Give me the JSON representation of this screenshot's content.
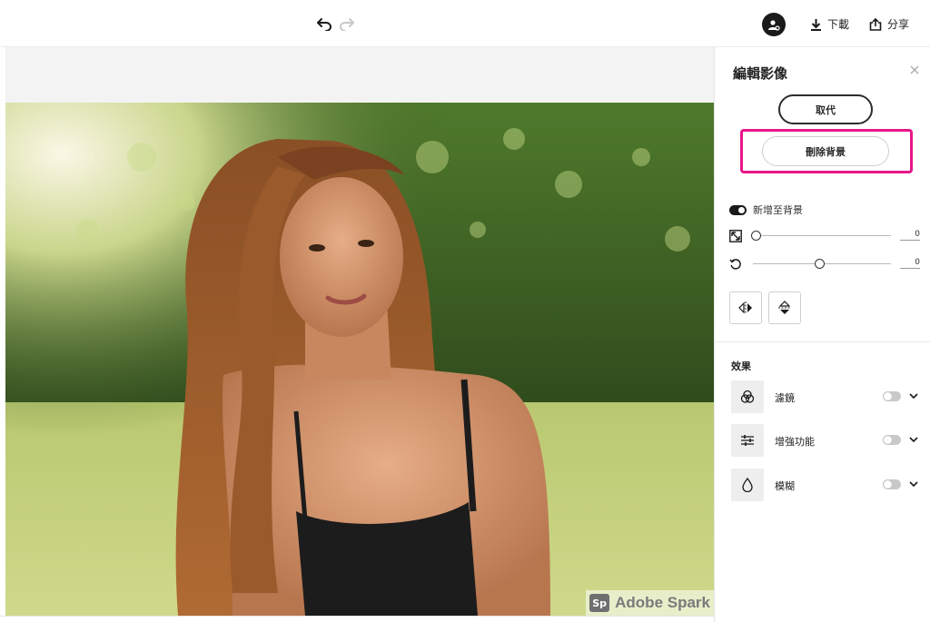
{
  "toolbar": {
    "download_label": "下載",
    "share_label": "分享"
  },
  "panel": {
    "title": "編輯影像",
    "replace_label": "取代",
    "remove_bg_label": "刪除背景",
    "add_to_bg_label": "新增至背景",
    "scale_value": "0",
    "rotate_value": "0",
    "effects_title": "效果",
    "effects": [
      {
        "label": "濾鏡",
        "enabled": false
      },
      {
        "label": "增強功能",
        "enabled": false
      },
      {
        "label": "模糊",
        "enabled": false
      }
    ]
  },
  "canvas": {
    "watermark_badge": "Sp",
    "watermark_text": "Adobe Spark"
  },
  "colors": {
    "highlight": "#e8178a",
    "toggle_on": "#1a1a1a",
    "toggle_off": "#c9c9c9"
  },
  "icons": [
    "undo-icon",
    "redo-icon",
    "avatar-icon",
    "download-icon",
    "share-icon",
    "close-icon",
    "scale-icon",
    "rotate-icon",
    "flip-horizontal-icon",
    "flip-vertical-icon",
    "filters-icon",
    "enhance-icon",
    "blur-icon",
    "chevron-down-icon"
  ]
}
